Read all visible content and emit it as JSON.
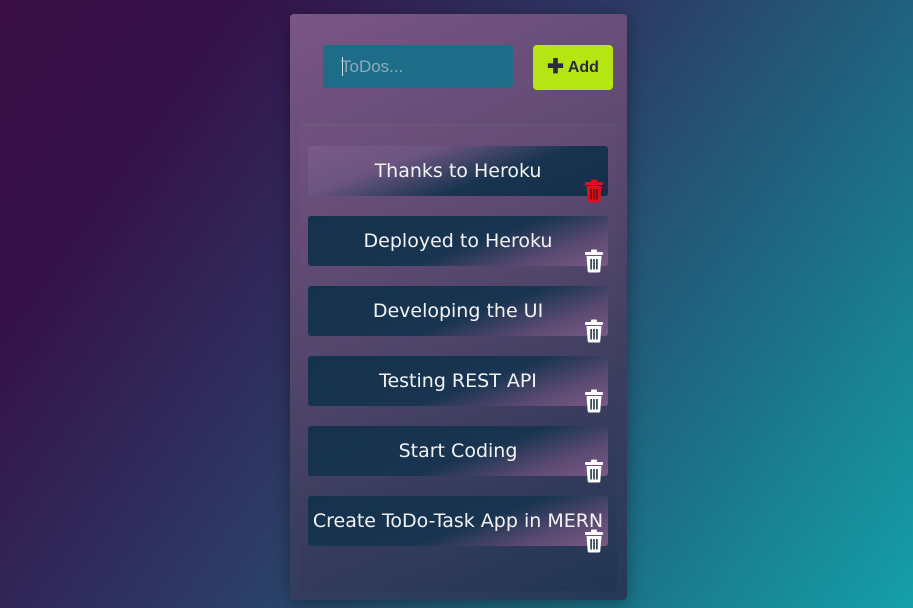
{
  "input": {
    "placeholder": "ToDos...",
    "value": ""
  },
  "add_button": {
    "label": "Add",
    "icon": "plus-icon"
  },
  "colors": {
    "add_button": "#b5e614",
    "input_bg": "#1e6d88",
    "trash_active": "#e0101a",
    "trash_default": "#ffffff"
  },
  "todos": [
    {
      "text": "Thanks to Heroku",
      "trash_icon": "trash-icon",
      "highlighted": true
    },
    {
      "text": "Deployed to Heroku",
      "trash_icon": "trash-icon",
      "highlighted": false
    },
    {
      "text": "Developing the UI",
      "trash_icon": "trash-icon",
      "highlighted": false
    },
    {
      "text": "Testing REST API",
      "trash_icon": "trash-icon",
      "highlighted": false
    },
    {
      "text": "Start Coding",
      "trash_icon": "trash-icon",
      "highlighted": false
    },
    {
      "text": "Create ToDo-Task App in MERN",
      "trash_icon": "trash-icon",
      "highlighted": false
    }
  ]
}
